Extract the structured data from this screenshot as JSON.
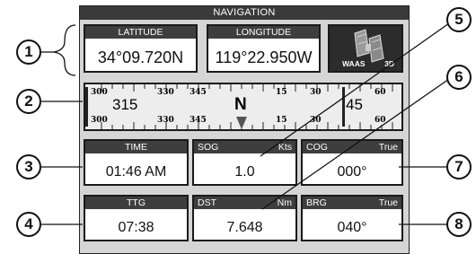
{
  "title": "NAVIGATION",
  "latitude": {
    "label": "LATITUDE",
    "value": "34°09.720N"
  },
  "longitude": {
    "label": "LONGITUDE",
    "value": "119°22.950W"
  },
  "gps_status": {
    "waas": "WAAS",
    "fix": "3D"
  },
  "compass": {
    "top_ticks": [
      "300",
      "330",
      "345",
      "15",
      "30",
      "60"
    ],
    "bottom_ticks": [
      "300",
      "330",
      "345",
      "15",
      "30",
      "60"
    ],
    "left_heading": "315",
    "right_heading": "45",
    "north": "N"
  },
  "time": {
    "label": "TIME",
    "value": "01:46 AM"
  },
  "sog": {
    "label": "SOG",
    "unit": "Kts",
    "value": "1.0"
  },
  "cog": {
    "label": "COG",
    "unit": "True",
    "value": "000°"
  },
  "ttg": {
    "label": "TTG",
    "value": "07:38"
  },
  "dst": {
    "label": "DST",
    "unit": "Nm",
    "value": "7.648"
  },
  "brg": {
    "label": "BRG",
    "unit": "True",
    "value": "040°"
  },
  "callouts": [
    "1",
    "2",
    "3",
    "4",
    "5",
    "6",
    "7",
    "8"
  ],
  "colors": {
    "header": "#3e3e3e",
    "screen": "#d5d5d5",
    "panel": "#ffffff",
    "border": "#1a1a1a"
  }
}
